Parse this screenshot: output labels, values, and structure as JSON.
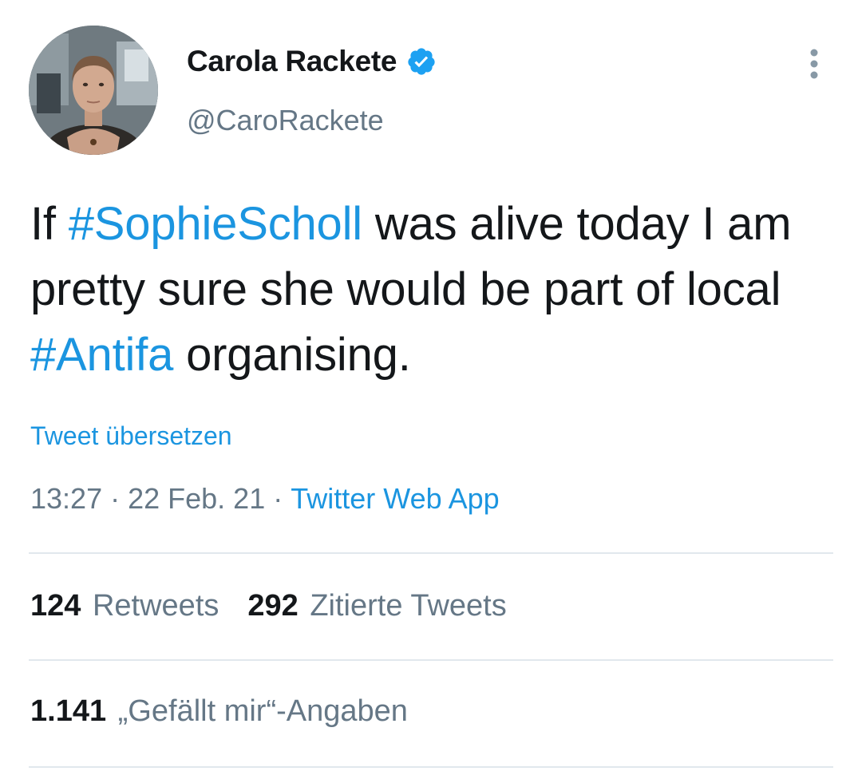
{
  "author": {
    "display_name": "Carola Rackete",
    "handle": "@CaroRackete",
    "verified": true
  },
  "icons": {
    "verified": "verified-badge-icon",
    "more": "more-vertical-icon"
  },
  "tweet": {
    "text_segments": [
      {
        "text": "If ",
        "type": "text"
      },
      {
        "text": "#SophieScholl",
        "type": "hashtag"
      },
      {
        "text": " was alive today I am pretty sure she would be part of local ",
        "type": "text"
      },
      {
        "text": "#Antifa",
        "type": "hashtag"
      },
      {
        "text": " organising.",
        "type": "text"
      }
    ],
    "translate_label": "Tweet übersetzen",
    "time": "13:27",
    "date": "22 Feb. 21",
    "separator": "·",
    "source": "Twitter Web App"
  },
  "stats": {
    "retweets_count": "124",
    "retweets_label": "Retweets",
    "quotes_count": "292",
    "quotes_label": "Zitierte Tweets",
    "likes_count": "1.141",
    "likes_label": "„Gefällt mir“-Angaben"
  },
  "colors": {
    "link": "#1b95e0",
    "text_primary": "#14171a",
    "text_secondary": "#657786",
    "divider": "#e1e8ed",
    "verified": "#1da1f2"
  }
}
